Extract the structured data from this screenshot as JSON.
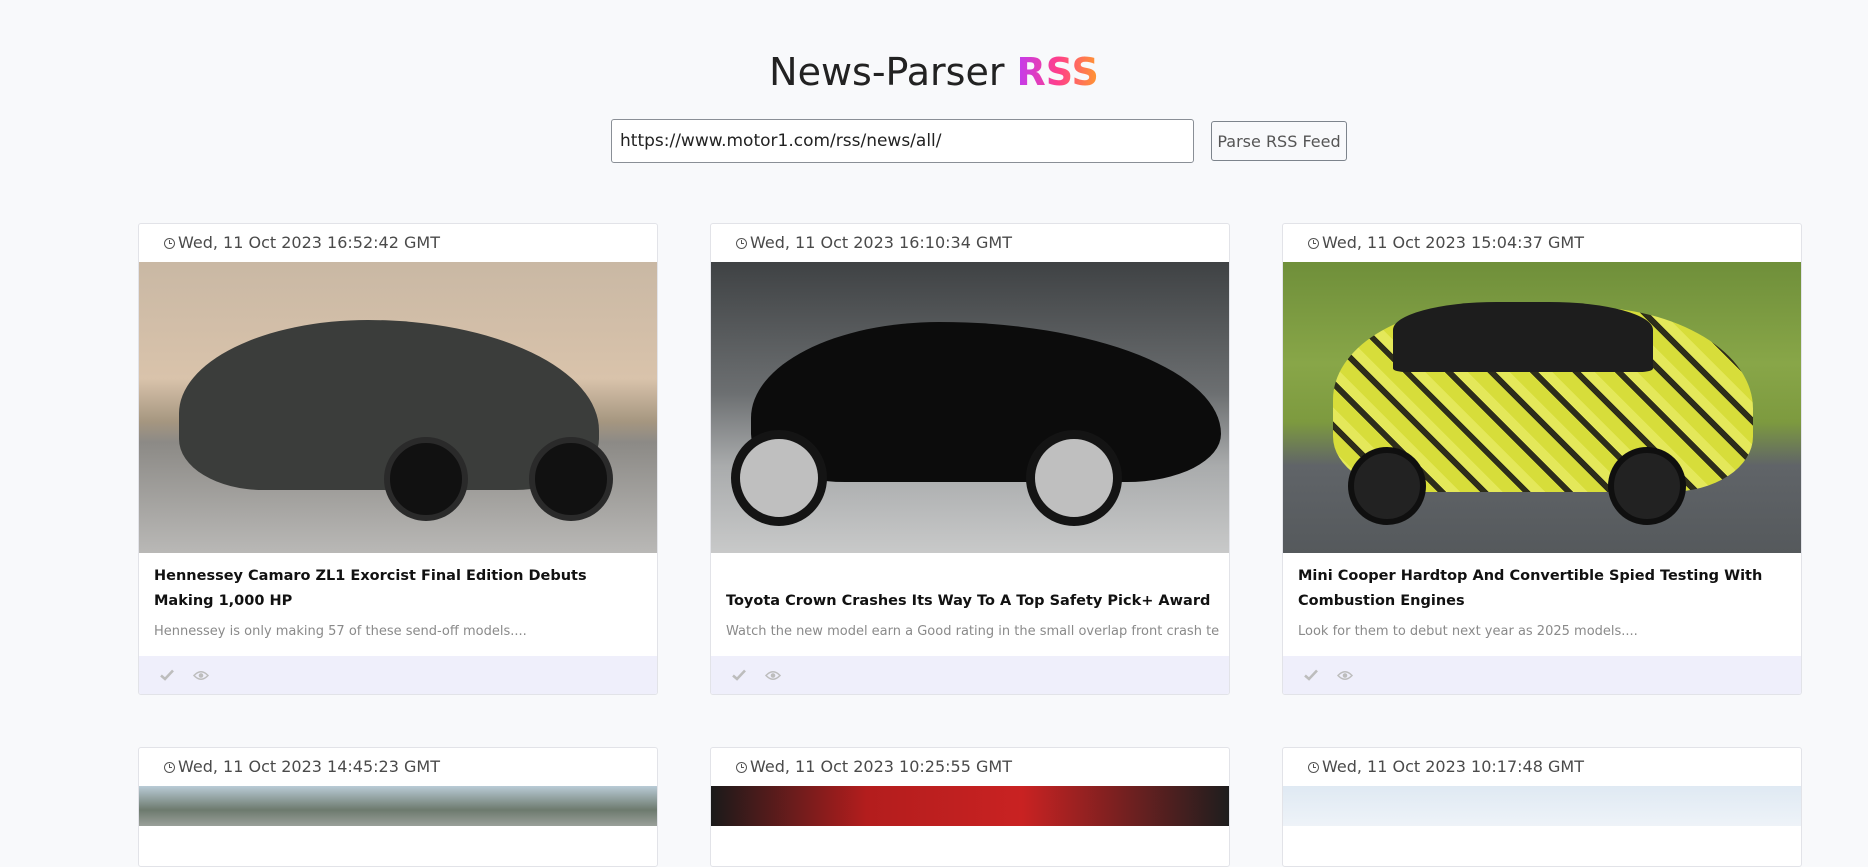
{
  "header": {
    "title_main": "News-Parser ",
    "title_accent": "RSS"
  },
  "search": {
    "url_value": "https://www.motor1.com/rss/news/all/",
    "button_label": "Parse RSS Feed"
  },
  "icons": {
    "clock": "clock-icon",
    "mark_read": "check-icon",
    "view": "eye-icon"
  },
  "colors": {
    "accent_gradient": [
      "#c23cf0",
      "#ff3f8a",
      "#ff9a2e"
    ],
    "card_footer_bg": "#efeffb"
  },
  "articles": [
    {
      "date": "Wed, 11 Oct 2023 16:52:42 GMT",
      "title": "Hennessey Camaro ZL1 Exorcist Final Edition Debuts Making 1,000 HP",
      "description": "Hennessey is only making 57 of these send-off models...."
    },
    {
      "date": "Wed, 11 Oct 2023 16:10:34 GMT",
      "title": "Toyota Crown Crashes Its Way To A Top Safety Pick+ Award",
      "description": "Watch the new model earn a Good rating in the small overlap front crash test...."
    },
    {
      "date": "Wed, 11 Oct 2023 15:04:37 GMT",
      "title": "Mini Cooper Hardtop And Convertible Spied Testing With Combustion Engines",
      "description": "Look for them to debut next year as 2025 models...."
    },
    {
      "date": "Wed, 11 Oct 2023 14:45:23 GMT"
    },
    {
      "date": "Wed, 11 Oct 2023 10:25:55 GMT"
    },
    {
      "date": "Wed, 11 Oct 2023 10:17:48 GMT"
    }
  ]
}
